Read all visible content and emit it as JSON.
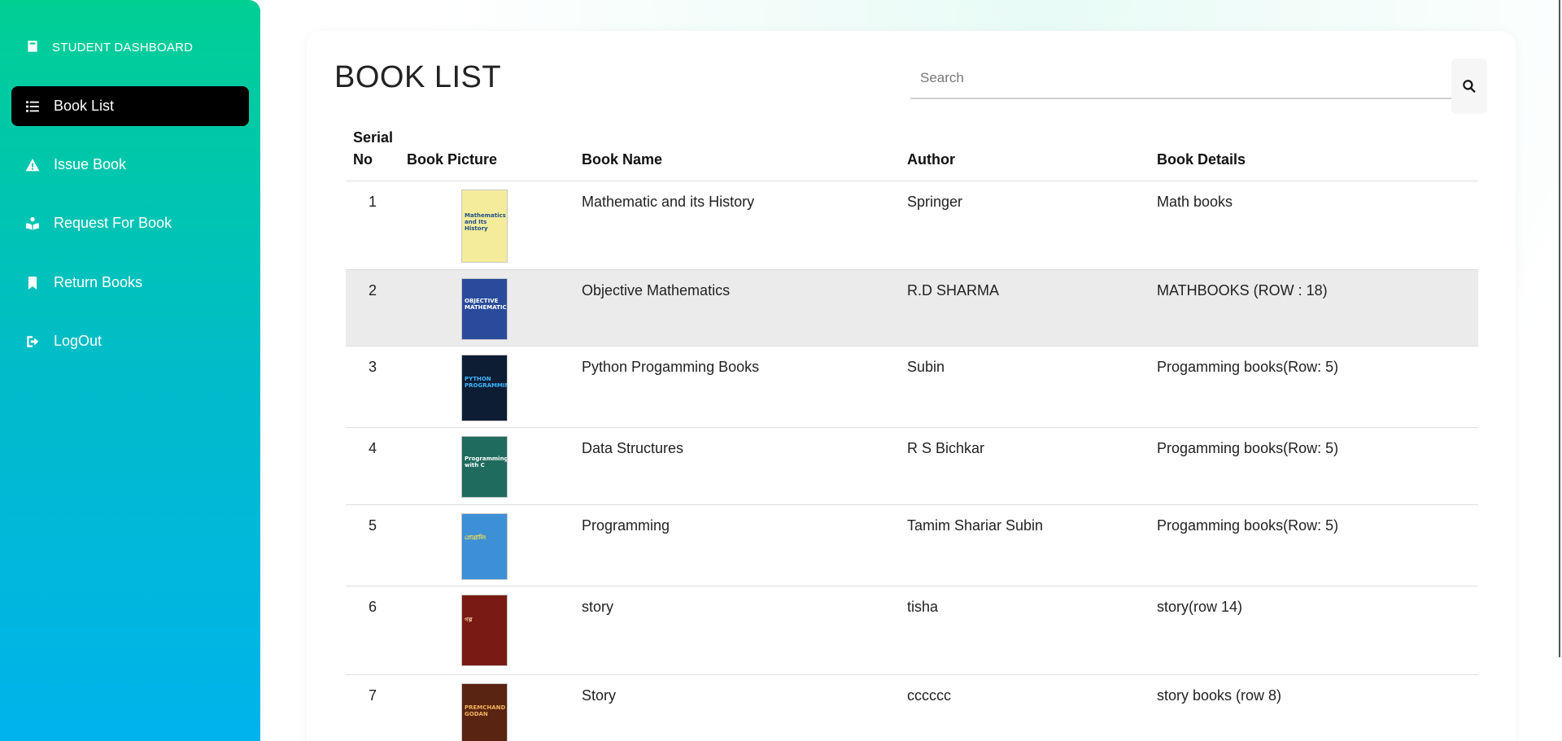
{
  "sidebar": {
    "brand": "STUDENT DASHBOARD",
    "items": [
      {
        "label": "Book List",
        "icon": "list-icon",
        "active": true
      },
      {
        "label": "Issue Book",
        "icon": "warning-icon",
        "active": false
      },
      {
        "label": "Request For Book",
        "icon": "reader-icon",
        "active": false
      },
      {
        "label": "Return Books",
        "icon": "bookmark-icon",
        "active": false
      },
      {
        "label": "LogOut",
        "icon": "logout-icon",
        "active": false
      }
    ]
  },
  "main": {
    "title": "BOOK LIST",
    "search": {
      "placeholder": "Search",
      "value": ""
    },
    "table": {
      "headers": {
        "serial_line1": "Serial",
        "serial_line2": "No",
        "picture": "Book Picture",
        "name": "Book Name",
        "author": "Author",
        "details": "Book Details"
      },
      "rows": [
        {
          "serial": "1",
          "name": "Mathematic and its History",
          "author": "Springer",
          "details": "Math books",
          "cover_text": "Mathematics and Its History",
          "cover_bg": "#f5ec9b",
          "cover_fg": "#1b4f8a"
        },
        {
          "serial": "2",
          "name": "Objective Mathematics",
          "author": "R.D SHARMA",
          "details": "MATHBOOKS (ROW : 18)",
          "cover_text": "OBJECTIVE MATHEMATICS",
          "cover_bg": "#2a4b9b",
          "cover_fg": "#ffffff"
        },
        {
          "serial": "3",
          "name": "Python Progamming Books",
          "author": "Subin",
          "details": "Progamming books(Row: 5)",
          "cover_text": "PYTHON PROGRAMMING",
          "cover_bg": "#0d1d33",
          "cover_fg": "#3fb7ff"
        },
        {
          "serial": "4",
          "name": "Data Structures",
          "author": "R S Bichkar",
          "details": "Progamming books(Row: 5)",
          "cover_text": "Programming with C",
          "cover_bg": "#1f6b5e",
          "cover_fg": "#ffffff"
        },
        {
          "serial": "5",
          "name": "Programming",
          "author": "Tamim Shariar Subin",
          "details": "Progamming books(Row: 5)",
          "cover_text": "প্রোগ্রামিং",
          "cover_bg": "#3d8fd6",
          "cover_fg": "#ffe04a"
        },
        {
          "serial": "6",
          "name": "story",
          "author": "tisha",
          "details": "story(row 14)",
          "cover_text": "গল্প",
          "cover_bg": "#7a1a14",
          "cover_fg": "#f6c7a0"
        },
        {
          "serial": "7",
          "name": "Story",
          "author": "cccccc",
          "details": "story books (row 8)",
          "cover_text": "PREMCHAND GODAN",
          "cover_bg": "#5a2412",
          "cover_fg": "#f0b35a"
        }
      ]
    }
  }
}
